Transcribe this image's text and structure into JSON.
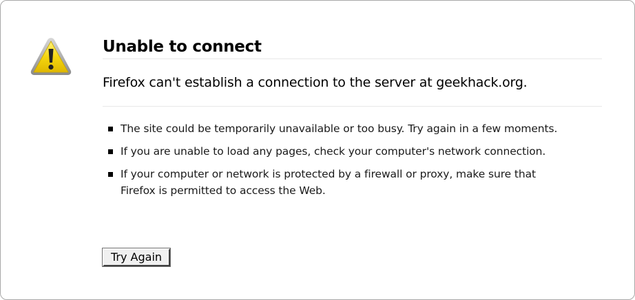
{
  "error": {
    "title": "Unable to connect",
    "short_description": "Firefox can't establish a connection to the server at geekhack.org.",
    "suggestions": [
      "The site could be temporarily unavailable or too busy. Try again in a few moments.",
      "If you are unable to load any pages, check your computer's network connection.",
      "If your computer or network is protected by a firewall or proxy, make sure that Firefox is permitted to access the Web."
    ],
    "icon": "warning-icon"
  },
  "actions": {
    "try_again_label": "Try Again"
  },
  "colors": {
    "icon_yellow": "#f5d60f",
    "icon_border": "#9a9a9a",
    "page_border": "#a8a8a8"
  }
}
